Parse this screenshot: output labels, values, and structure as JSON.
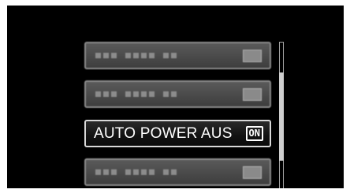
{
  "menu": {
    "items": [
      {
        "label": "",
        "state": "dimmed"
      },
      {
        "label": "",
        "state": "dimmed"
      },
      {
        "label": "AUTO POWER AUS",
        "value": "ON",
        "state": "selected"
      },
      {
        "label": "",
        "state": "dimmed"
      }
    ],
    "selected_index": 2
  },
  "scrollbar": {
    "position": 0.5,
    "visible_fraction": 0.6
  },
  "colors": {
    "background": "#000000",
    "item_border_selected": "#d8d8d8",
    "item_border_dim": "#8a8a8a",
    "text": "#ffffff"
  }
}
